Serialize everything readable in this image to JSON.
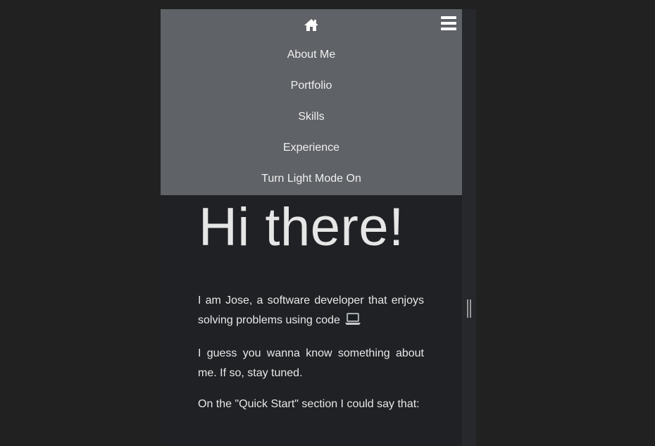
{
  "nav": {
    "items": [
      {
        "id": "about",
        "label": "About Me"
      },
      {
        "id": "portfolio",
        "label": "Portfolio"
      },
      {
        "id": "skills",
        "label": "Skills"
      },
      {
        "id": "experience",
        "label": "Experience"
      },
      {
        "id": "theme",
        "label": "Turn Light Mode On"
      }
    ],
    "home_icon": "home-icon",
    "menu_icon": "hamburger-menu-icon"
  },
  "hero": {
    "title": "Hi there!"
  },
  "intro": {
    "p1": "I am Jose, a software developer that enjoys solving problems using code",
    "p1_icon": "laptop-icon",
    "p2": "I guess you wanna know something about me. If so, stay tuned.",
    "p3": "On the \"Quick Start\" section I could say that:"
  },
  "colors": {
    "background": "#212121",
    "page": "#202124",
    "menu": "#5f6266",
    "text": "#e8e8e8"
  }
}
